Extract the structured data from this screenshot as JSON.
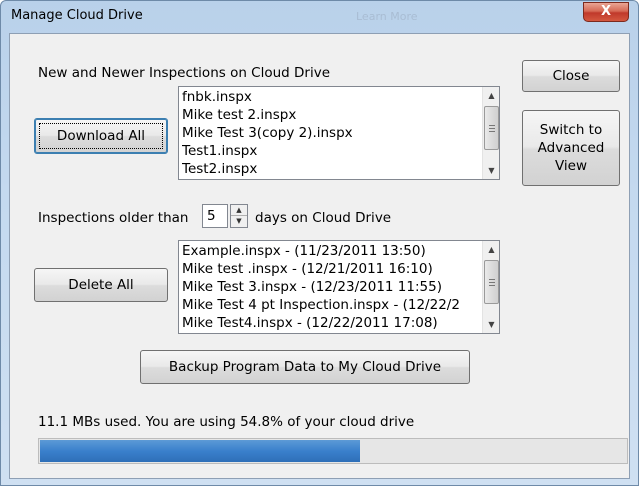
{
  "window": {
    "title": "Manage Cloud Drive",
    "ghost_title": "Learn More",
    "close_glyph": "X"
  },
  "new_section": {
    "label": "New and Newer Inspections on Cloud Drive",
    "download_button": "Download All",
    "files": [
      "fnbk.inspx",
      "Mike  test 2.inspx",
      "Mike Test 3(copy 2).inspx",
      "Test1.inspx",
      "Test2.inspx"
    ]
  },
  "side_buttons": {
    "close": "Close",
    "switch_line1": "Switch to",
    "switch_line2": "Advanced",
    "switch_line3": "View"
  },
  "older_section": {
    "label_prefix": "Inspections older than",
    "days_value": "5",
    "label_suffix": "days on Cloud Drive",
    "delete_button": "Delete All",
    "files": [
      "Example.inspx - (11/23/2011 13:50)",
      "Mike test .inspx - (12/21/2011 16:10)",
      "Mike Test 3.inspx - (12/23/2011 11:55)",
      "Mike Test 4 pt Inspection.inspx - (12/22/2",
      "Mike Test4.inspx - (12/22/2011 17:08)"
    ]
  },
  "backup_button": "Backup Program Data to My Cloud Drive",
  "usage": {
    "text": "11.1 MBs used. You are using 54.8% of your cloud drive",
    "percent": 54.8
  },
  "icons": {
    "scroll_up": "▲",
    "scroll_down": "▼",
    "spin_up": "▲",
    "spin_down": "▼"
  }
}
